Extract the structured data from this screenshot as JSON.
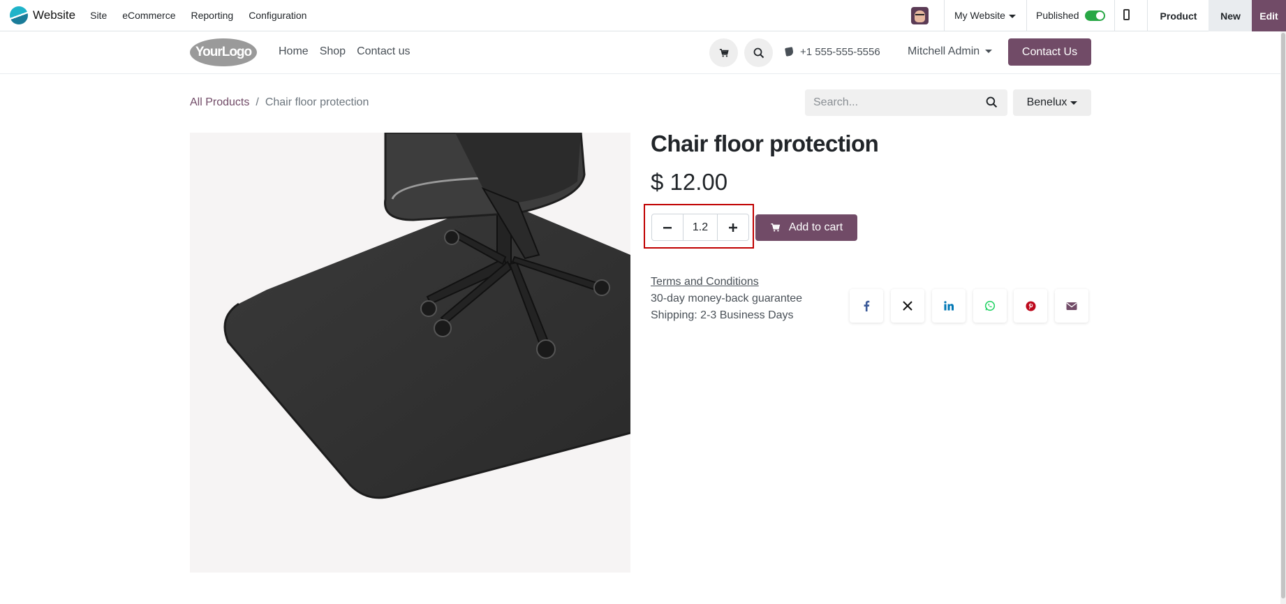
{
  "admin_bar": {
    "app_name": "Website",
    "menu": [
      "Site",
      "eCommerce",
      "Reporting",
      "Configuration"
    ],
    "website_selector": "My Website",
    "published_label": "Published",
    "published": true,
    "product_button": "Product",
    "new_button": "New",
    "edit_button": "Edit"
  },
  "header": {
    "logo_text": "YourLogo",
    "nav": [
      "Home",
      "Shop",
      "Contact us"
    ],
    "phone": "+1 555-555-5556",
    "user": "Mitchell Admin",
    "contact_button": "Contact Us"
  },
  "breadcrumb": {
    "root": "All Products",
    "separator": "/",
    "current": "Chair floor protection"
  },
  "search": {
    "placeholder": "Search...",
    "value": ""
  },
  "pricelist": "Benelux",
  "product": {
    "name": "Chair floor protection",
    "price": "$ 12.00",
    "quantity": "1.2",
    "add_to_cart": "Add to cart",
    "terms": "Terms and Conditions",
    "guarantee": "30-day money-back guarantee",
    "shipping": "Shipping: 2-3 Business Days"
  },
  "share_icons": [
    "facebook-icon",
    "x-icon",
    "linkedin-icon",
    "whatsapp-icon",
    "pinterest-icon",
    "email-icon"
  ],
  "colors": {
    "brand": "#714b67",
    "toggle_on": "#28a745",
    "highlight": "#c00000",
    "facebook": "#3b5998",
    "linkedin": "#0077b5",
    "whatsapp": "#25d366",
    "pinterest": "#bd081c"
  }
}
